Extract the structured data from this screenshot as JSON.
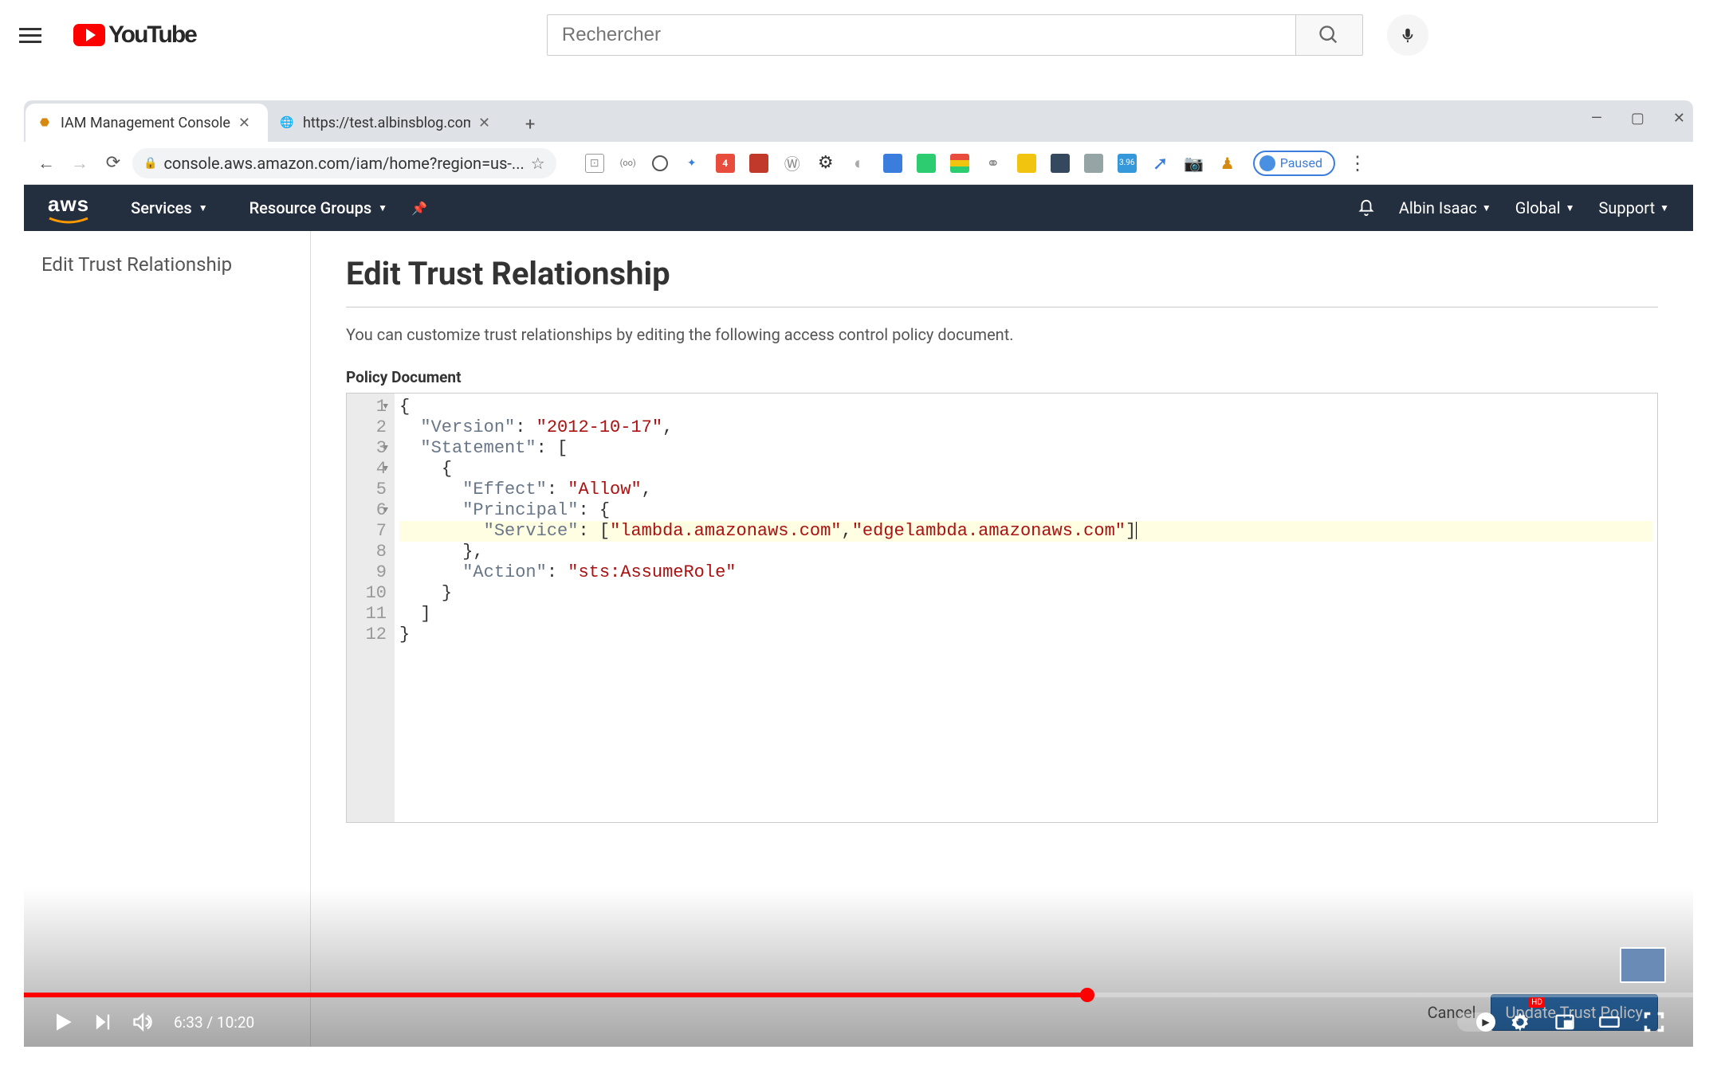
{
  "youtube": {
    "brand": "YouTube",
    "search_placeholder": "Rechercher",
    "player": {
      "current_time": "6:33",
      "duration": "10:20",
      "progress_percent": 63.7
    }
  },
  "chrome": {
    "tabs": [
      {
        "title": "IAM Management Console",
        "active": true
      },
      {
        "title": "https://test.albinsblog.com/us/en",
        "truncated": "https://test.albinsblog.com/us/en..."
      }
    ],
    "url": "console.aws.amazon.com/iam/home?region=us-...",
    "paused_label": "Paused"
  },
  "aws": {
    "nav": {
      "services": "Services",
      "resource_groups": "Resource Groups",
      "user": "Albin Isaac",
      "region": "Global",
      "support": "Support"
    },
    "sidebar_title": "Edit Trust Relationship",
    "page_title": "Edit Trust Relationship",
    "description": "You can customize trust relationships by editing the following access control policy document.",
    "policy_label": "Policy Document",
    "policy_version": "2012-10-17",
    "policy_effect": "Allow",
    "policy_services": [
      "lambda.amazonaws.com",
      "edgelambda.amazonaws.com"
    ],
    "policy_action": "sts:AssumeRole",
    "buttons": {
      "cancel": "Cancel",
      "update": "Update Trust Policy"
    },
    "code_lines": {
      "l1": "{",
      "l2a": "\"Version\"",
      "l2b": ": ",
      "l2c": "\"2012-10-17\"",
      "l2d": ",",
      "l3a": "\"Statement\"",
      "l3b": ": [",
      "l4": "{",
      "l5a": "\"Effect\"",
      "l5b": ": ",
      "l5c": "\"Allow\"",
      "l5d": ",",
      "l6a": "\"Principal\"",
      "l6b": ": {",
      "l7a": "\"Service\"",
      "l7b": ": [",
      "l7c": "\"lambda.amazonaws.com\"",
      "l7d": ",",
      "l7e": "\"edgelambda.amazonaws.com\"",
      "l7f": "]",
      "l8": "},",
      "l9a": "\"Action\"",
      "l9b": ": ",
      "l9c": "\"sts:AssumeRole\"",
      "l10": "}",
      "l11": "]",
      "l12": "}"
    },
    "line_numbers": [
      "1",
      "2",
      "3",
      "4",
      "5",
      "6",
      "7",
      "8",
      "9",
      "10",
      "11",
      "12"
    ]
  }
}
